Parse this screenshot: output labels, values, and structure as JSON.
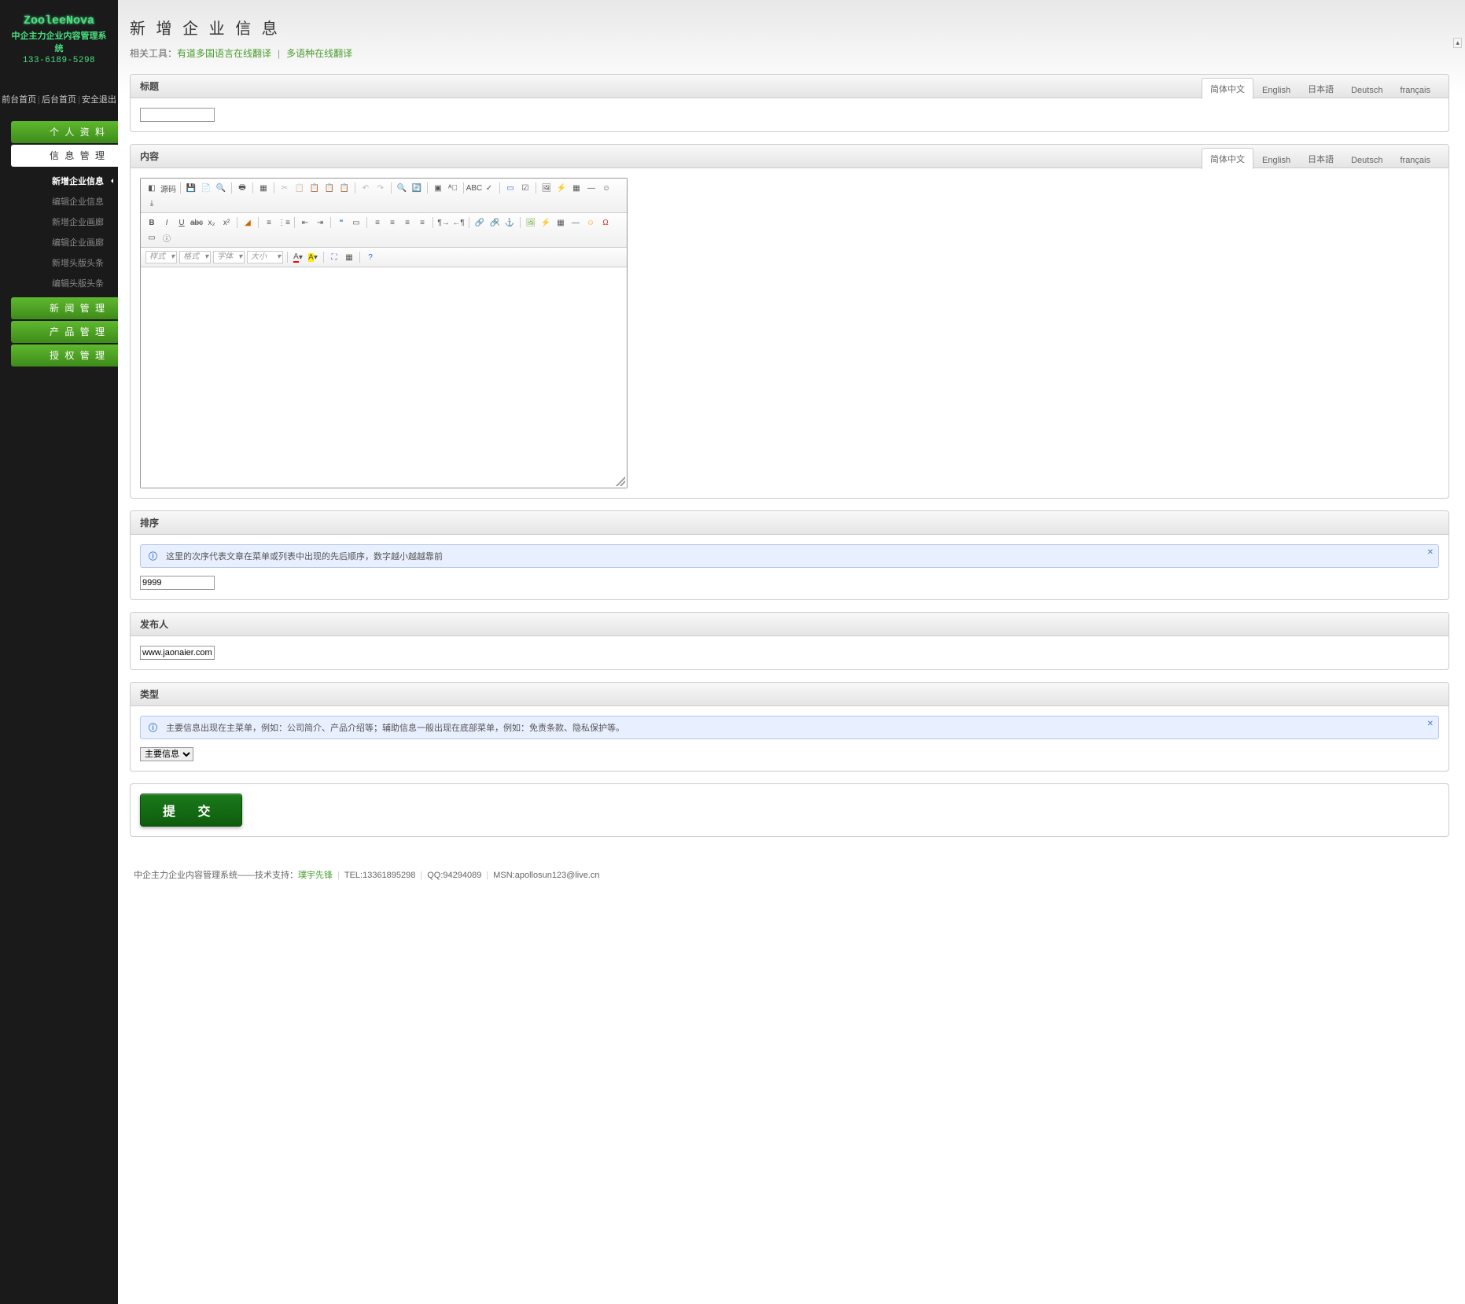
{
  "logo": {
    "name": "ZooleeNova",
    "sub": "中企主力企业内容管理系统",
    "tel": "133-6189-5298"
  },
  "topLinks": {
    "front": "前台首页",
    "back": "后台首页",
    "logout": "安全退出"
  },
  "nav": {
    "profile": "个 人 资 料",
    "info": "信 息 管 理",
    "news": "新 闻 管 理",
    "product": "产 品 管 理",
    "auth": "授 权 管 理"
  },
  "subNav": {
    "addInfo": "新增企业信息",
    "editInfo": "编辑企业信息",
    "addGallery": "新增企业画廊",
    "editGallery": "编辑企业画廊",
    "addHeader": "新增头版头条",
    "editHeader": "编辑头版头条"
  },
  "page": {
    "title": "新 增 企 业 信 息",
    "toolsLabel": "相关工具：",
    "tool1": "有道多国语言在线翻译",
    "tool2": "多语种在线翻译"
  },
  "langs": {
    "zh": "简体中文",
    "en": "English",
    "ja": "日本語",
    "de": "Deutsch",
    "fr": "français"
  },
  "panels": {
    "title": "标题",
    "content": "内容",
    "sort": "排序",
    "sortHint": "这里的次序代表文章在菜单或列表中出现的先后顺序，数字越小越越靠前",
    "sortValue": "9999",
    "publisher": "发布人",
    "publisherValue": "www.jaonaier.com",
    "type": "类型",
    "typeHint": "主要信息出现在主菜单，例如：公司简介、产品介绍等；辅助信息一般出现在底部菜单，例如：免责条款、隐私保护等。",
    "typeValue": "主要信息"
  },
  "editor": {
    "source": "源码",
    "style": "样式",
    "format": "格式",
    "font": "字体",
    "size": "大小"
  },
  "submit": "提 交",
  "footer": {
    "text1": "中企主力企业内容管理系统——技术支持：",
    "link": "璞宇先锋",
    "tel": "TEL:13361895298",
    "qq": "QQ:94294089",
    "msn": "MSN:apollosun123@live.cn"
  }
}
